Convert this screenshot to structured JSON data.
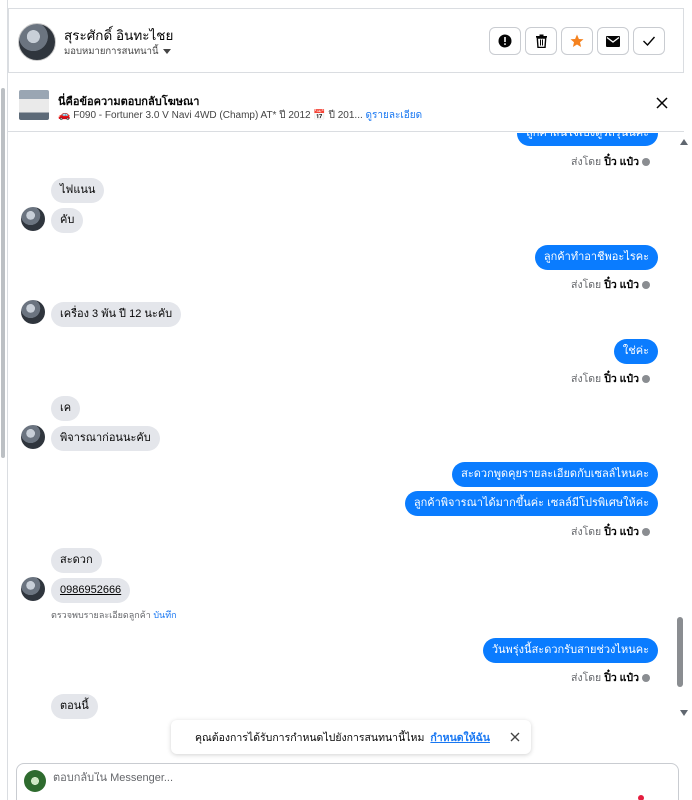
{
  "header": {
    "user_name": "สุระศักดิ์ อินทะไชย",
    "assign_label": "มอบหมายการสนทนานี้"
  },
  "ad": {
    "title": "นี่คือข้อความตอบกลับโฆษณา",
    "subtitle": "🚗 F090 - Fortuner 3.0 V Navi 4WD (Champ) AT* ปี 2012 📅 ปี 201...",
    "link": "ดูรายละเอียด"
  },
  "sent_by": {
    "prefix": "ส่งโดย",
    "name": "ปิ๋ว แป๋ว"
  },
  "messages": {
    "m1": "ลูกค้าสนใจเบิ่งดูรถรุ่นนี้คะ",
    "m2": "ไฟแนน",
    "m3": "คับ",
    "m4": "ลูกค้าทำอาชีพอะไรคะ",
    "m5": "เครื่อง 3 พัน ปี 12 นะคับ",
    "m6": "ใช่ค่ะ",
    "m7": "เค",
    "m8": "พิจารณาก่อนนะคับ",
    "m9": "สะดวกพูดคุยรายละเอียดกับเซลล์ไหนคะ",
    "m10": "ลูกค้าพิจารณาได้มากขึ้นค่ะ เซลล์มีโปรพิเศษให้ค่ะ",
    "m11": "สะดวก",
    "m12": "0986952666",
    "m13": "วันพรุ่งนี้สะดวกรับสายช่วงไหนคะ",
    "m14": "ตอนนี้"
  },
  "detected_note": {
    "text": "ตรวจพบรายละเอียดลูกค้า",
    "action": "บันทึก"
  },
  "toast": {
    "text": "คุณต้องการได้รับการกำหนดไปยังการสนทนานี้ไหม",
    "link": "กำหนดให้ฉัน"
  },
  "composer": {
    "placeholder": "ตอบกลับใน Messenger..."
  },
  "colors": {
    "outgoing_bubble": "#0a7cff",
    "incoming_bubble": "#e4e6eb",
    "link": "#1877f2",
    "star": "#f5821f"
  },
  "icons": [
    "alert-icon",
    "trash-icon",
    "star-icon",
    "mail-icon",
    "check-icon",
    "close-icon",
    "info-icon"
  ]
}
